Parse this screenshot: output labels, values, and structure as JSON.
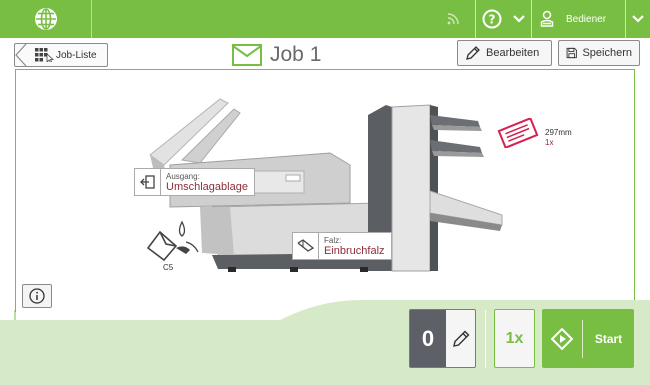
{
  "topbar": {
    "user_label": "Bediener",
    "icons": [
      "globe-icon",
      "rss-icon",
      "help-icon",
      "chevron-down-icon",
      "user-icon",
      "chevron-down-icon"
    ]
  },
  "header": {
    "back_label": "Job-Liste",
    "title": "Job 1",
    "edit_label": "Bearbeiten",
    "save_label": "Speichern"
  },
  "machine": {
    "output": {
      "key": "Ausgang:",
      "value": "Umschlagablage"
    },
    "fold": {
      "key": "Falz:",
      "value": "Einbruchfalz"
    },
    "envelope_size": "C5",
    "document": {
      "size": "297mm",
      "count": "1x"
    }
  },
  "bottom": {
    "counter": "0",
    "quantity": "1x",
    "start_label": "Start"
  },
  "colors": {
    "accent": "#78be43",
    "value_text": "#8b2d3a",
    "document_red": "#d6204e"
  }
}
